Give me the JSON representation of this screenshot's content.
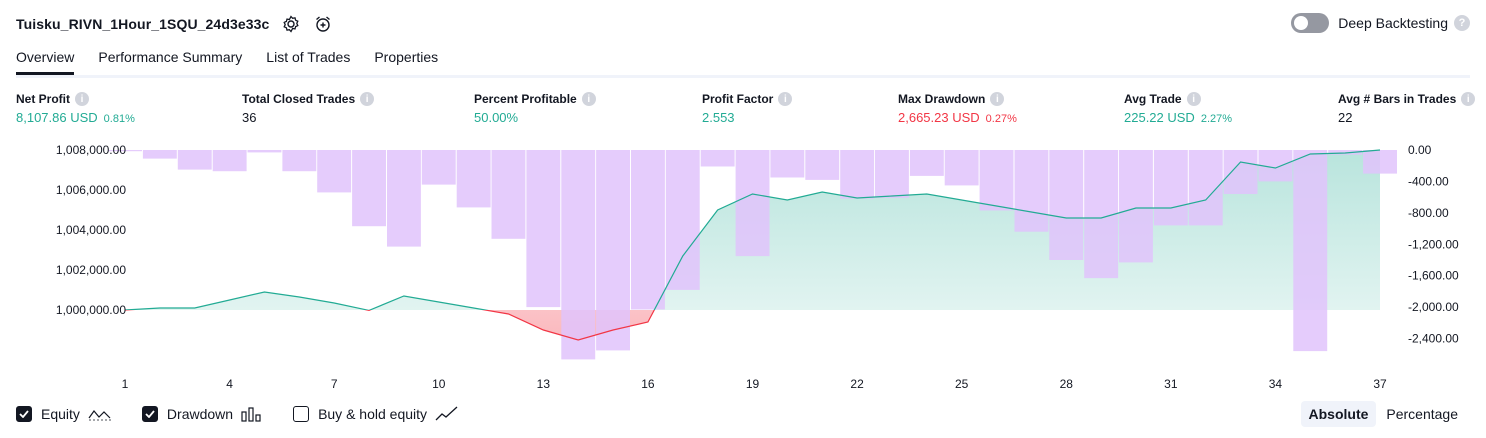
{
  "header": {
    "title": "Tuisku_RIVN_1Hour_1SQU_24d3e33c",
    "deep_backtesting_label": "Deep Backtesting"
  },
  "tabs": [
    {
      "label": "Overview",
      "active": true
    },
    {
      "label": "Performance Summary",
      "active": false
    },
    {
      "label": "List of Trades",
      "active": false
    },
    {
      "label": "Properties",
      "active": false
    }
  ],
  "stats": [
    {
      "label": "Net Profit",
      "value": "8,107.86 USD",
      "pct": "0.81%",
      "color": "green"
    },
    {
      "label": "Total Closed Trades",
      "value": "36",
      "pct": "",
      "color": "dark"
    },
    {
      "label": "Percent Profitable",
      "value": "50.00%",
      "pct": "",
      "color": "green"
    },
    {
      "label": "Profit Factor",
      "value": "2.553",
      "pct": "",
      "color": "green"
    },
    {
      "label": "Max Drawdown",
      "value": "2,665.23 USD",
      "pct": "0.27%",
      "color": "red"
    },
    {
      "label": "Avg Trade",
      "value": "225.22 USD",
      "pct": "2.27%",
      "color": "green"
    },
    {
      "label": "Avg # Bars in Trades",
      "value": "22",
      "pct": "",
      "color": "dark"
    }
  ],
  "legend": {
    "equity_label": "Equity",
    "drawdown_label": "Drawdown",
    "buy_hold_label": "Buy & hold equity",
    "equity_checked": true,
    "drawdown_checked": true,
    "buy_hold_checked": false
  },
  "mode": {
    "absolute_label": "Absolute",
    "percentage_label": "Percentage",
    "active": "absolute"
  },
  "colors": {
    "equity_line": "#22ab94",
    "equity_negative_line": "#f23645",
    "drawdown_bar": "#e1c3fc",
    "profit": "#22ab94",
    "loss": "#f23645"
  },
  "chart_data": {
    "type": "area",
    "x": [
      1,
      2,
      3,
      4,
      5,
      6,
      7,
      8,
      9,
      10,
      11,
      12,
      13,
      14,
      15,
      16,
      17,
      18,
      19,
      20,
      21,
      22,
      23,
      24,
      25,
      26,
      27,
      28,
      29,
      30,
      31,
      32,
      33,
      34,
      35,
      36,
      37
    ],
    "x_ticks": [
      "1",
      "4",
      "7",
      "10",
      "13",
      "16",
      "19",
      "22",
      "25",
      "28",
      "31",
      "34",
      "37"
    ],
    "left_axis": {
      "ticks": [
        "1,008,000.00",
        "1,006,000.00",
        "1,004,000.00",
        "1,002,000.00",
        "1,000,000.00"
      ],
      "ylim": [
        997000,
        1008000
      ]
    },
    "right_axis": {
      "ticks": [
        "0.00",
        "-400.00",
        "-800.00",
        "-1,200.00",
        "-1,600.00",
        "-2,000.00",
        "-2,400.00"
      ],
      "ylim": [
        -2800,
        0
      ]
    },
    "series": [
      {
        "name": "Equity",
        "axis": "left",
        "values": [
          1000000,
          1000100,
          1000100,
          1000500,
          1000900,
          1000650,
          1000350,
          999980,
          1000700,
          1000400,
          1000100,
          999800,
          999000,
          998500,
          999000,
          999400,
          1002700,
          1005000,
          1005800,
          1005500,
          1005900,
          1005600,
          1005700,
          1005800,
          1005500,
          1005200,
          1004900,
          1004600,
          1004600,
          1005100,
          1005100,
          1005500,
          1007400,
          1007100,
          1007800,
          1007850,
          1008000
        ]
      },
      {
        "name": "Drawdown",
        "axis": "right",
        "values": [
          -15,
          -110,
          -250,
          -270,
          -30,
          -270,
          -540,
          -970,
          -1230,
          -440,
          -730,
          -1130,
          -2000,
          -2665,
          -2550,
          -2030,
          -1780,
          -210,
          -1350,
          -350,
          -380,
          -620,
          -610,
          -330,
          -450,
          -770,
          -1040,
          -1400,
          -1630,
          -1430,
          -960,
          -960,
          -560,
          -400,
          -2560,
          -60,
          -300
        ]
      }
    ]
  }
}
